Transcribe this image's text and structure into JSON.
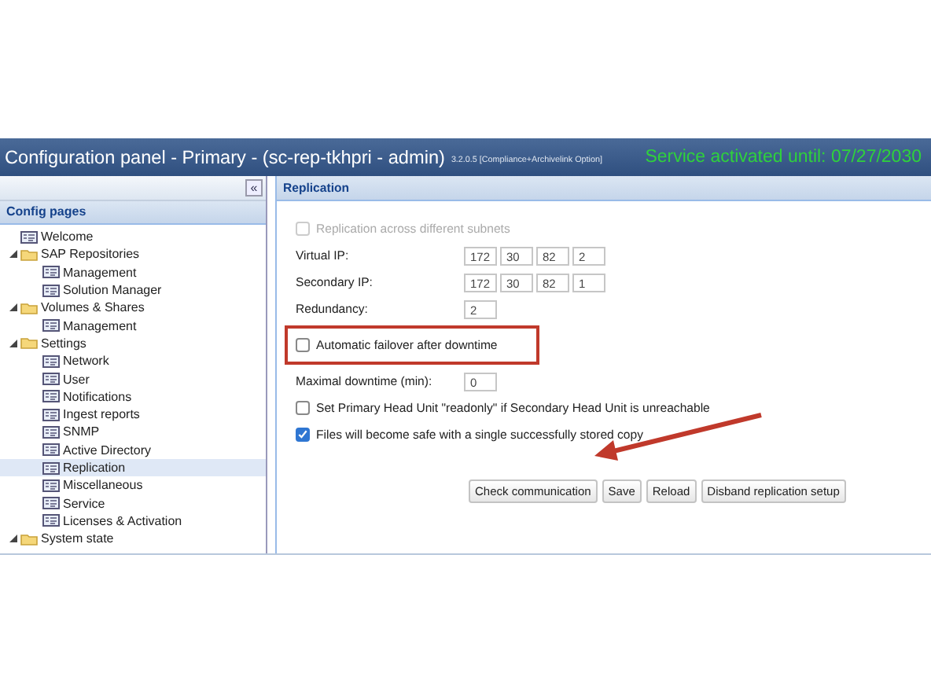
{
  "window": {
    "title": "Configuration panel - Primary - (sc-rep-tkhpri - admin)",
    "version": "3.2.0.5 [Compliance+Archivelink Option]",
    "status": "Service activated until: 07/27/2030"
  },
  "sidebar": {
    "collapse": "«",
    "title": "Config pages",
    "items": [
      {
        "kind": "page",
        "label": "Welcome",
        "selected": false
      },
      {
        "kind": "folder",
        "label": "SAP Repositories",
        "expanded": true,
        "children": [
          {
            "kind": "page",
            "label": "Management",
            "selected": false
          },
          {
            "kind": "page",
            "label": "Solution Manager",
            "selected": false
          }
        ]
      },
      {
        "kind": "folder",
        "label": "Volumes & Shares",
        "expanded": true,
        "children": [
          {
            "kind": "page",
            "label": "Management",
            "selected": false
          }
        ]
      },
      {
        "kind": "folder",
        "label": "Settings",
        "expanded": true,
        "children": [
          {
            "kind": "page",
            "label": "Network",
            "selected": false
          },
          {
            "kind": "page",
            "label": "User",
            "selected": false
          },
          {
            "kind": "page",
            "label": "Notifications",
            "selected": false
          },
          {
            "kind": "page",
            "label": "Ingest reports",
            "selected": false
          },
          {
            "kind": "page",
            "label": "SNMP",
            "selected": false
          },
          {
            "kind": "page",
            "label": "Active Directory",
            "selected": false
          },
          {
            "kind": "page",
            "label": "Replication",
            "selected": true
          },
          {
            "kind": "page",
            "label": "Miscellaneous",
            "selected": false
          },
          {
            "kind": "page",
            "label": "Service",
            "selected": false
          },
          {
            "kind": "page",
            "label": "Licenses & Activation",
            "selected": false
          }
        ]
      },
      {
        "kind": "folder",
        "label": "System state",
        "expanded": true
      }
    ]
  },
  "panel": {
    "title": "Replication",
    "fields": [
      {
        "kind": "checkbox",
        "label": "Replication across different subnets",
        "checked": false,
        "disabled": true
      },
      {
        "kind": "ip",
        "label": "Virtual IP:",
        "values": [
          "172",
          "30",
          "82",
          "2"
        ]
      },
      {
        "kind": "ip",
        "label": "Secondary IP:",
        "values": [
          "172",
          "30",
          "82",
          "1"
        ]
      },
      {
        "kind": "number",
        "label": "Redundancy:",
        "value": "2"
      },
      {
        "kind": "checkbox",
        "label": "Automatic failover after downtime",
        "checked": false,
        "disabled": false,
        "highlighted": true
      },
      {
        "kind": "number",
        "label": "Maximal downtime (min):",
        "value": "0"
      },
      {
        "kind": "checkbox",
        "label": "Set Primary Head Unit \"readonly\" if Secondary Head Unit is unreachable",
        "checked": false,
        "disabled": false
      },
      {
        "kind": "checkbox",
        "label": "Files will become safe with a single successfully stored copy",
        "checked": true,
        "disabled": false
      }
    ],
    "buttons": [
      "Check communication",
      "Save",
      "Reload",
      "Disband replication setup"
    ]
  }
}
